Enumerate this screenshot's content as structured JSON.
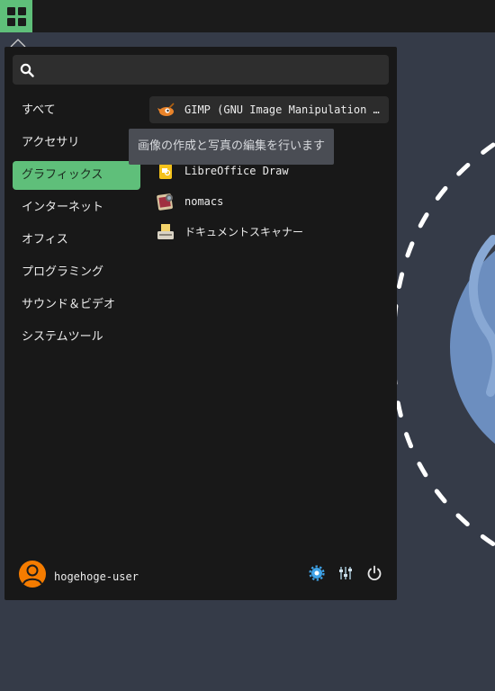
{
  "panel": {
    "apps_button_icon": "grid-icon"
  },
  "search": {
    "placeholder": "",
    "value": "",
    "icon": "search-icon"
  },
  "categories": [
    {
      "label": "すべて",
      "active": false
    },
    {
      "label": "アクセサリ",
      "active": false
    },
    {
      "label": "グラフィックス",
      "active": true
    },
    {
      "label": "インターネット",
      "active": false
    },
    {
      "label": "オフィス",
      "active": false
    },
    {
      "label": "プログラミング",
      "active": false
    },
    {
      "label": "サウンド＆ビデオ",
      "active": false
    },
    {
      "label": "システムツール",
      "active": false
    }
  ],
  "apps": [
    {
      "label": "GIMP (GNU Image Manipulation …",
      "icon": "gimp-icon"
    },
    {
      "label": "LibreOffice Draw",
      "icon": "libreoffice-draw-icon"
    },
    {
      "label": "nomacs",
      "icon": "nomacs-icon"
    },
    {
      "label": "ドキュメントスキャナー",
      "icon": "scanner-icon"
    }
  ],
  "tooltip": {
    "text": "画像の作成と写真の編集を行います"
  },
  "user": {
    "name": "hogehoge-user",
    "icon": "user-avatar-icon"
  },
  "footer_buttons": [
    "settings-icon",
    "mixer-icon",
    "power-icon"
  ],
  "colors": {
    "accent": "#5fbf7a",
    "menu_bg": "#181818",
    "desktop_bg": "#353b48",
    "avatar": "#f57c00"
  }
}
